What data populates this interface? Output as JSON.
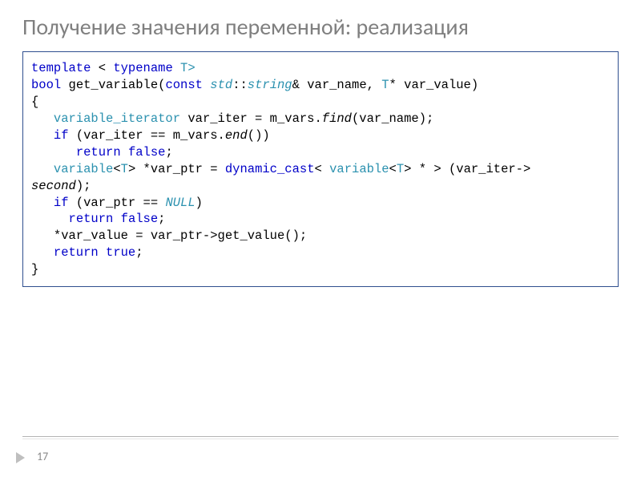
{
  "slide": {
    "title": "Получение значения переменной: реализация",
    "page_number": "17"
  },
  "code": {
    "l1_a": "template",
    "l1_b": " < ",
    "l1_c": "typename",
    "l1_d": " T>",
    "l2_a": "bool",
    "l2_b": " get_variable(",
    "l2_c": "const",
    "l2_d": " ",
    "l2_e": "std",
    "l2_f": "::",
    "l2_g": "string",
    "l2_h": "& var_name, ",
    "l2_i": "T",
    "l2_j": "* var_value)",
    "l3": "{",
    "l4_a": "   ",
    "l4_b": "variable_iterator",
    "l4_c": " var_iter = m_vars.",
    "l4_d": "find",
    "l4_e": "(var_name);",
    "l5_a": "   ",
    "l5_b": "if",
    "l5_c": " (var_iter == m_vars.",
    "l5_d": "end",
    "l5_e": "())",
    "l6_a": "      ",
    "l6_b": "return",
    "l6_c": " ",
    "l6_d": "false",
    "l6_e": ";",
    "l7_a": "   ",
    "l7_b": "variable",
    "l7_c": "<",
    "l7_d": "T",
    "l7_e": "> *var_ptr = ",
    "l7_f": "dynamic_cast",
    "l7_g": "< ",
    "l7_h": "variable",
    "l7_i": "<",
    "l7_j": "T",
    "l7_k": "> * > (var_iter->",
    "l8_a": "second",
    "l8_b": ");",
    "l9_a": "   ",
    "l9_b": "if",
    "l9_c": " (var_ptr == ",
    "l9_d": "NULL",
    "l9_e": ")",
    "l10_a": "     ",
    "l10_b": "return",
    "l10_c": " ",
    "l10_d": "false",
    "l10_e": ";",
    "l11_a": "   *var_value = var_ptr->",
    "l11_b": "get_value",
    "l11_c": "();",
    "l12_a": "   ",
    "l12_b": "return",
    "l12_c": " ",
    "l12_d": "true",
    "l12_e": ";",
    "l13": "}"
  }
}
